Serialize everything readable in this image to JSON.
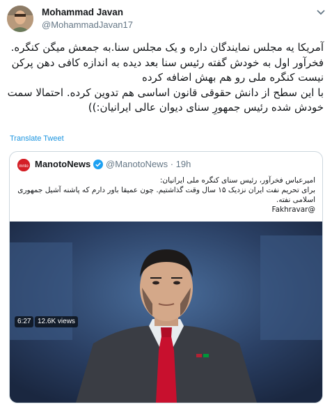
{
  "tweet": {
    "author_name": "Mohammad Javan",
    "author_handle": "@MohammadJavan17",
    "body_lines": [
      "آمریکا یه مجلس نمایندگان داره و یک مجلس سنا.به جمعش میگن کنگره.",
      "فخرآور اول به خودش گفته رئیس سنا بعد دیده به اندازه کافی دهن پرکن",
      "نیست کنگره ملی رو هم بهش اضافه کرده",
      "با این سطح از دانش حقوقی قانون اساسی  هم تدوین کرده. احتمالا سمت",
      "خودش شده رئیس جمهورِ سنای دیوان عالی ایرانیان:))"
    ],
    "translate_label": "Translate Tweet"
  },
  "quoted": {
    "name": "ManotoNews",
    "handle": "@ManotoNews",
    "time": "19h",
    "separator": "·",
    "body_lines": [
      "امیرعباس فخرآور، رئیس سنای کنگره ملی ایرانیان:",
      "برای تحریم نفت ایران نزدیک ۱۵ سال وقت گذاشتیم. چون عمیقا باور دارم که پاشنه آشیل جمهوری",
      "اسلامی نفته.",
      "@Fakhravar"
    ],
    "video": {
      "duration": "6:27",
      "views": "12.6K views"
    }
  },
  "colors": {
    "link": "#1b95e0",
    "secondary_text": "#657786",
    "border": "#ccd6dd",
    "brand_red": "#d41f26"
  },
  "icons": [
    "chevron-down-icon",
    "verified-badge-icon",
    "manoto-logo-icon"
  ]
}
